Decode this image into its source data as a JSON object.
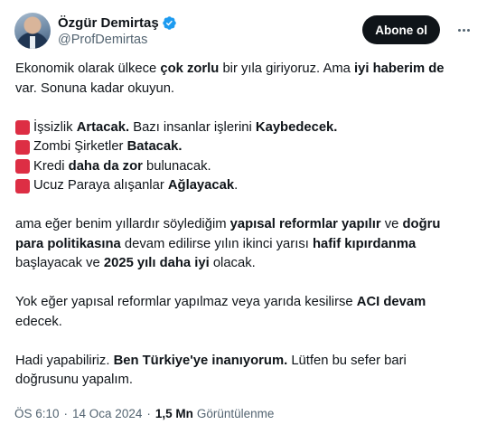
{
  "author": {
    "name": "Özgür Demirtaş",
    "handle": "@ProfDemirtas",
    "verified_color": "#1d9bf0"
  },
  "actions": {
    "follow_label": "Abone ol",
    "more_icon": "ellipsis-icon"
  },
  "tweet": {
    "p1": [
      {
        "t": "Ekonomik olarak ülkece ",
        "b": false
      },
      {
        "t": "çok zorlu",
        "b": true
      },
      {
        "t": " bir yıla giriyoruz. Ama ",
        "b": false
      },
      {
        "t": "iyi haberim de",
        "b": true
      }
    ],
    "p1_line2": "var. Sonuna kadar okuyun.",
    "bullets": [
      [
        {
          "t": "İşsizlik ",
          "b": false
        },
        {
          "t": "Artacak.",
          "b": true
        },
        {
          "t": " Bazı insanlar işlerini ",
          "b": false
        },
        {
          "t": "Kaybedecek.",
          "b": true
        }
      ],
      [
        {
          "t": "Zombi Şirketler ",
          "b": false
        },
        {
          "t": "Batacak.",
          "b": true
        }
      ],
      [
        {
          "t": "Kredi ",
          "b": false
        },
        {
          "t": "daha da zor",
          "b": true
        },
        {
          "t": " bulunacak.",
          "b": false
        }
      ],
      [
        {
          "t": "Ucuz Paraya alışanlar ",
          "b": false
        },
        {
          "t": "Ağlayacak",
          "b": true
        },
        {
          "t": ".",
          "b": false
        }
      ]
    ],
    "bullet_icon": "red-square-emoji",
    "bullet_color": "#dd2e44",
    "p2_lines": [
      [
        {
          "t": "ama eğer benim yıllardır söylediğim ",
          "b": false
        },
        {
          "t": "yapısal reformlar yapılır",
          "b": true
        },
        {
          "t": " ve ",
          "b": false
        },
        {
          "t": "doğru",
          "b": true
        }
      ],
      [
        {
          "t": "para politikasına",
          "b": true
        },
        {
          "t": " devam edilirse yılın ikinci yarısı ",
          "b": false
        },
        {
          "t": "hafif kıpırdanma",
          "b": true
        }
      ],
      [
        {
          "t": "başlayacak ve ",
          "b": false
        },
        {
          "t": "2025 yılı daha iyi",
          "b": true
        },
        {
          "t": " olacak.",
          "b": false
        }
      ]
    ],
    "p3_lines": [
      [
        {
          "t": "Yok eğer yapısal reformlar yapılmaz veya yarıda kesilirse ",
          "b": false
        },
        {
          "t": "ACI devam",
          "b": true
        }
      ],
      [
        {
          "t": "edecek.",
          "b": false
        }
      ]
    ],
    "p4_lines": [
      [
        {
          "t": "Hadi yapabiliriz. ",
          "b": false
        },
        {
          "t": "Ben Türkiye'ye inanıyorum.",
          "b": true
        },
        {
          "t": " Lütfen bu sefer bari",
          "b": false
        }
      ],
      [
        {
          "t": "doğrusunu yapalım.",
          "b": false
        }
      ]
    ]
  },
  "meta": {
    "time": "ÖS 6:10",
    "separator": "·",
    "date": "14 Oca 2024",
    "views_count": "1,5 Mn",
    "views_label": "Görüntülenme"
  }
}
